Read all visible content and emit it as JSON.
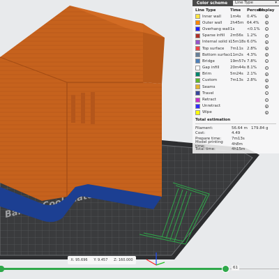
{
  "legend": {
    "header_title": "Color scheme",
    "header_select": "Line Type",
    "columns": {
      "type": "Line Type",
      "time": "Time",
      "percent": "Percent",
      "display": "Display"
    },
    "rows": [
      {
        "label": "Inner wall",
        "time": "1m4s",
        "percent": "0.4%",
        "color": "#ffe640"
      },
      {
        "label": "Outer wall",
        "time": "2h45m",
        "percent": "64.4%",
        "color": "#ff8800"
      },
      {
        "label": "Overhang wall",
        "time": "1s",
        "percent": "<0.1%",
        "color": "#1f1fff"
      },
      {
        "label": "Sparse infill",
        "time": "2m56s",
        "percent": "1.2%",
        "color": "#b03029"
      },
      {
        "label": "Internal solid infill",
        "time": "15m18s",
        "percent": "6.0%",
        "color": "#9654cc"
      },
      {
        "label": "Top surface",
        "time": "7m11s",
        "percent": "2.8%",
        "color": "#f04545"
      },
      {
        "label": "Bottom surface",
        "time": "11m2s",
        "percent": "4.3%",
        "color": "#66809a"
      },
      {
        "label": "Bridge",
        "time": "19m57s",
        "percent": "7.8%",
        "color": "#4d80ba"
      },
      {
        "label": "Gap infill",
        "time": "20m44s",
        "percent": "8.1%",
        "color": "#ffffff"
      },
      {
        "label": "Brim",
        "time": "5m24s",
        "percent": "2.1%",
        "color": "#00876e"
      },
      {
        "label": "Custom",
        "time": "7m13s",
        "percent": "2.8%",
        "color": "#5eb82e"
      },
      {
        "label": "Seams",
        "time": "",
        "percent": "",
        "color": "#e6b52e"
      },
      {
        "label": "Travel",
        "time": "",
        "percent": "",
        "color": "#38489c"
      },
      {
        "label": "Retract",
        "time": "",
        "percent": "",
        "color": "#cc2ecc"
      },
      {
        "label": "Unretract",
        "time": "",
        "percent": "",
        "color": "#3030ff"
      },
      {
        "label": "Wipe",
        "time": "",
        "percent": "",
        "color": "#ffff00"
      }
    ],
    "estimation": {
      "title": "Total estimation",
      "rows": [
        {
          "key": "Filament:",
          "v1": "56.64 m",
          "v2": "179.84 g"
        },
        {
          "key": "Cost:",
          "v1": "4.49",
          "v2": ""
        },
        {
          "key": "Prepare time:",
          "v1": "7m13s",
          "v2": ""
        },
        {
          "key": "Model printing time:",
          "v1": "4h8m",
          "v2": ""
        },
        {
          "key": "Total time:",
          "v1": "4h15m",
          "v2": ""
        }
      ]
    }
  },
  "plate_label": "Bambu Cool Plate",
  "coords": {
    "x": "X: 95.696",
    "y": "Y: 9.457",
    "z": "Z: 160.000"
  },
  "layer_slider": {
    "value": "61",
    "fill_fraction": 0.81
  },
  "colors": {
    "model": "#c6621d",
    "bed": "#3a3b3d",
    "slider": "#2fa84a"
  }
}
